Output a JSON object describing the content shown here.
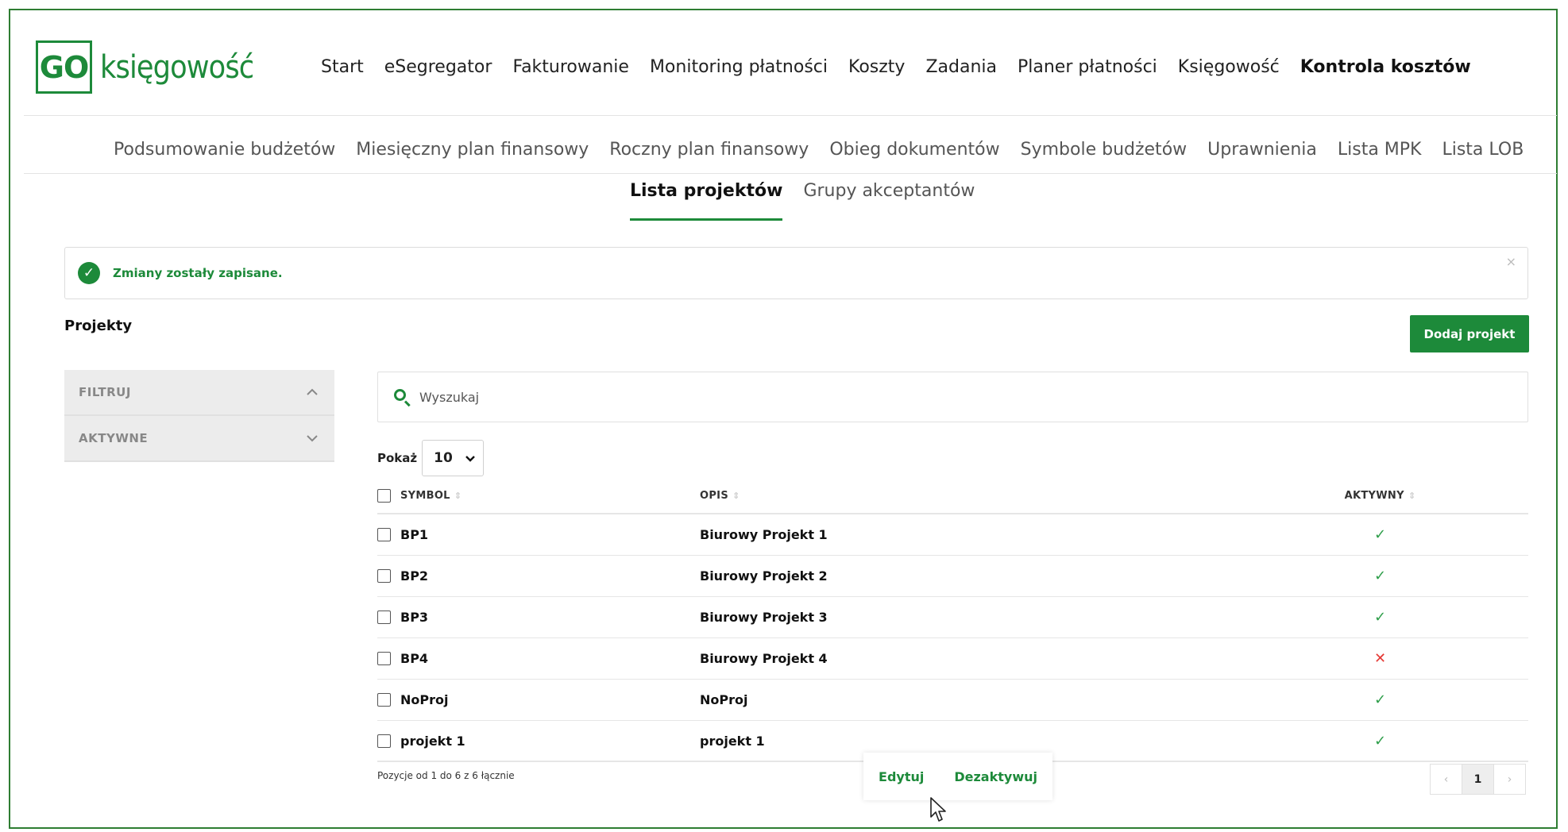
{
  "logo": {
    "box": "GO",
    "text": "księgowość"
  },
  "main_nav": [
    {
      "label": "Start",
      "active": false
    },
    {
      "label": "eSegregator",
      "active": false
    },
    {
      "label": "Fakturowanie",
      "active": false
    },
    {
      "label": "Monitoring płatności",
      "active": false
    },
    {
      "label": "Koszty",
      "active": false
    },
    {
      "label": "Zadania",
      "active": false
    },
    {
      "label": "Planer płatności",
      "active": false
    },
    {
      "label": "Księgowość",
      "active": false
    },
    {
      "label": "Kontrola kosztów",
      "active": true
    }
  ],
  "sub_nav": [
    "Podsumowanie budżetów",
    "Miesięczny plan finansowy",
    "Roczny plan finansowy",
    "Obieg dokumentów",
    "Symbole budżetów",
    "Uprawnienia",
    "Lista MPK",
    "Lista LOB"
  ],
  "tabs": [
    {
      "label": "Lista projektów",
      "active": true
    },
    {
      "label": "Grupy akceptantów",
      "active": false
    }
  ],
  "alert": {
    "text": "Zmiany zostały zapisane.",
    "close": "×",
    "icon": "check-circle-icon"
  },
  "page_title": "Projekty",
  "add_button": "Dodaj projekt",
  "filters": [
    {
      "label": "FILTRUJ",
      "chevron": "up"
    },
    {
      "label": "AKTYWNE",
      "chevron": "down"
    }
  ],
  "search": {
    "placeholder": "Wyszukaj",
    "value": ""
  },
  "show": {
    "label": "Pokaż",
    "value": "10"
  },
  "table": {
    "columns": [
      "SYMBOL",
      "OPIS",
      "AKTYWNY"
    ],
    "rows": [
      {
        "symbol": "BP1",
        "desc": "Biurowy Projekt 1",
        "active": true
      },
      {
        "symbol": "BP2",
        "desc": "Biurowy Projekt 2",
        "active": true
      },
      {
        "symbol": "BP3",
        "desc": "Biurowy Projekt 3",
        "active": true
      },
      {
        "symbol": "BP4",
        "desc": "Biurowy Projekt 4",
        "active": false
      },
      {
        "symbol": "NoProj",
        "desc": "NoProj",
        "active": true
      },
      {
        "symbol": "projekt 1",
        "desc": "projekt 1",
        "active": true
      }
    ]
  },
  "footer_info": "Pozycje od 1 do 6 z 6 łącznie",
  "pagination": {
    "prev": "‹",
    "current": "1",
    "next": "›"
  },
  "popup_actions": [
    "Edytuj",
    "Dezaktywuj"
  ],
  "colors": {
    "brand_green": "#1d8a3a",
    "ok": "#2e9e4a",
    "error": "#e53935"
  }
}
